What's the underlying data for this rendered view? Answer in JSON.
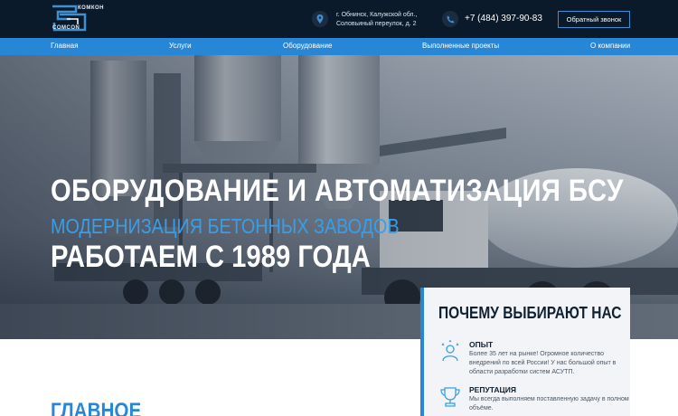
{
  "header": {
    "logo_top": "КОМКОН",
    "logo_bottom": "COMCON",
    "address_lines": [
      "г. Обнинск, Калужской обл.,",
      "Соловьиный переулок, д. 2"
    ],
    "phone": "+7 (484) 397-90-83",
    "callback_label": "Обратный звонок"
  },
  "nav": {
    "items": [
      "Главная",
      "Услуги",
      "Оборудование",
      "Выполненные проекты",
      "О компании"
    ]
  },
  "hero": {
    "line1": "ОБОРУДОВАНИЕ И АВТОМАТИЗАЦИЯ БСУ",
    "line2": "МОДЕРНИЗАЦИЯ БЕТОННЫХ ЗАВОДОВ",
    "line3": "РАБОТАЕМ С 1989 ГОДА"
  },
  "why": {
    "title": "ПОЧЕМУ ВЫБИРАЮТ НАС",
    "items": [
      {
        "icon": "expert-icon",
        "title": "ОПЫТ",
        "text": "Более 35 лет на рынке! Огромное количество внедрений по всей России! У нас большой опыт в области разработки систем АСУТП."
      },
      {
        "icon": "trophy-icon",
        "title": "РЕПУТАЦИЯ",
        "text": "Мы всегда выполняем поставленную задачу в полном объёме."
      }
    ]
  },
  "main": {
    "heading": "ГЛАВНОЕ"
  },
  "colors": {
    "header_bg": "#0b1a2b",
    "nav_bg": "#2787d6",
    "accent": "#3a9ee6"
  }
}
